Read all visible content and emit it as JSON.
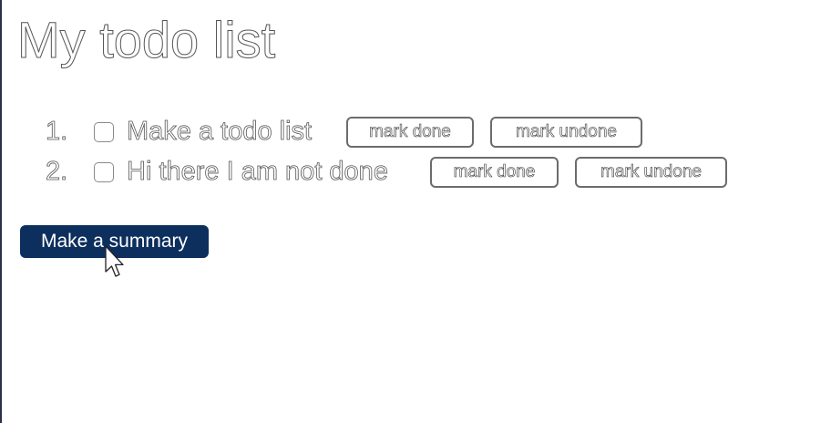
{
  "page": {
    "title": "My todo list"
  },
  "todos": [
    {
      "number": "1.",
      "text": "Make a todo list",
      "checked": false,
      "mark_done_label": "mark done",
      "mark_undone_label": "mark undone"
    },
    {
      "number": "2.",
      "text": "Hi there I am not done",
      "checked": false,
      "mark_done_label": "mark done",
      "mark_undone_label": "mark undone"
    }
  ],
  "summary_button": {
    "label": "Make a summary"
  },
  "colors": {
    "primary_button": "#0d2f5e",
    "outline": "#555555"
  },
  "icons": {
    "cursor": "mouse-pointer-icon"
  }
}
